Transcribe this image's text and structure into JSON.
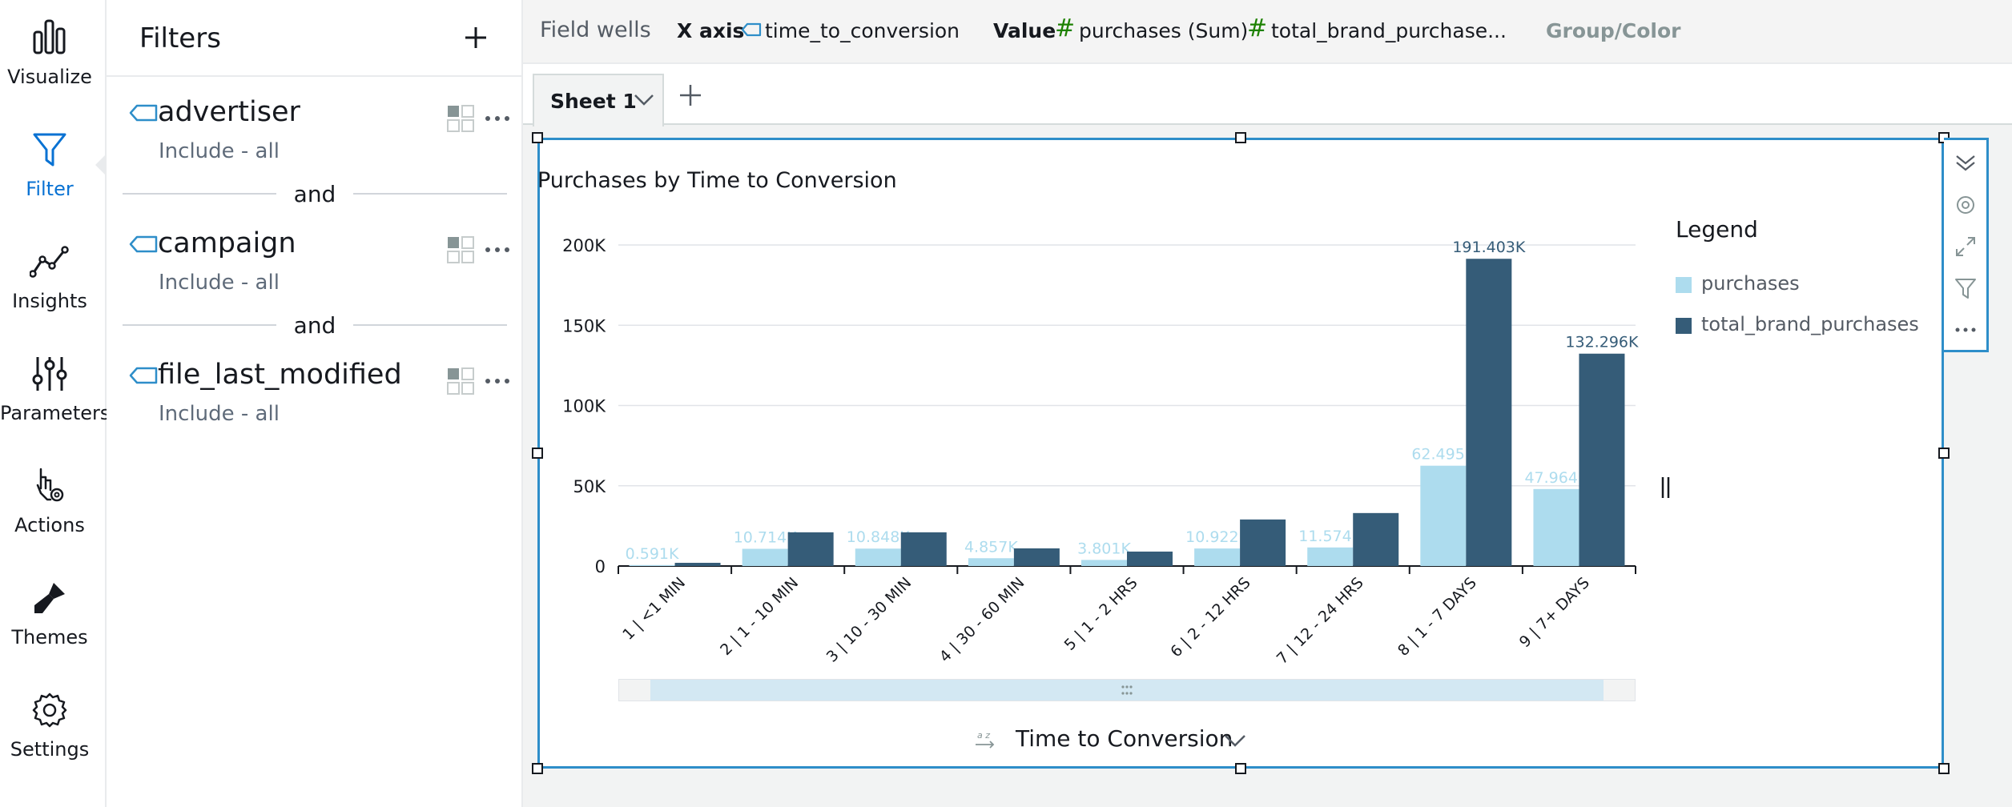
{
  "rail": {
    "items": [
      {
        "label": "Visualize",
        "icon": "bar-chart-icon"
      },
      {
        "label": "Filter",
        "icon": "funnel-icon",
        "active": true
      },
      {
        "label": "Insights",
        "icon": "line-insight-icon"
      },
      {
        "label": "Parameters",
        "icon": "sliders-icon"
      },
      {
        "label": "Actions",
        "icon": "hand-gear-icon"
      },
      {
        "label": "Themes",
        "icon": "brush-icon"
      },
      {
        "label": "Settings",
        "icon": "gear-icon"
      }
    ]
  },
  "filters": {
    "title": "Filters",
    "add_icon": "plus-icon",
    "connector": "and",
    "items": [
      {
        "name": "advertiser",
        "sub": "Include - all"
      },
      {
        "name": "campaign",
        "sub": "Include - all"
      },
      {
        "name": "file_last_modified",
        "sub": "Include - all"
      }
    ]
  },
  "wells": {
    "label": "Field wells",
    "x_axis_label": "X axis",
    "x_axis_field": "time_to_conversion",
    "value_label": "Value",
    "value_field_1": "purchases (Sum)",
    "value_field_2": "total_brand_purchase...",
    "group_label": "Group/Color"
  },
  "sheet": {
    "tab_label": "Sheet 1",
    "add_icon": "plus-icon"
  },
  "visual": {
    "title": "Purchases by Time to Conversion",
    "legend_title": "Legend",
    "x_control_label": "Time to Conversion"
  },
  "colors": {
    "accent": "#0972d3",
    "selection_border": "#2e8ec9",
    "purchases": "#addcee",
    "total_brand_purchases": "#355c78",
    "well_value_icon": "#1d8102"
  },
  "chart_data": {
    "type": "bar",
    "title": "Purchases by Time to Conversion",
    "xlabel": "Time to Conversion",
    "ylabel": "",
    "ylim": [
      0,
      200000
    ],
    "yticks": [
      {
        "value": 0,
        "label": "0"
      },
      {
        "value": 50000,
        "label": "50K"
      },
      {
        "value": 100000,
        "label": "100K"
      },
      {
        "value": 150000,
        "label": "150K"
      },
      {
        "value": 200000,
        "label": "200K"
      }
    ],
    "grid": true,
    "legend_position": "right",
    "categories": [
      "1 | <1 MIN",
      "2 | 1 - 10 MIN",
      "3 | 10 - 30 MIN",
      "4 | 30 - 60 MIN",
      "5 | 1 - 2 HRS",
      "6 | 2 - 12 HRS",
      "7 | 12 - 24 HRS",
      "8 | 1 - 7 DAYS",
      "9 | 7+ DAYS"
    ],
    "series": [
      {
        "name": "purchases",
        "values": [
          591,
          10714,
          10848,
          4857,
          3801,
          10922,
          11574,
          62495,
          47964
        ],
        "labels": [
          "0.591K",
          "10.714K",
          "10.848K",
          "4.857K",
          "3.801K",
          "10.922K",
          "11.574K",
          "62.495K",
          "47.964K"
        ]
      },
      {
        "name": "total_brand_purchases",
        "values": [
          2000,
          21000,
          21000,
          11000,
          9000,
          29000,
          33000,
          191403,
          132296
        ],
        "labels": [
          "",
          "",
          "",
          "",
          "",
          "",
          "",
          "191.403K",
          "132.296K"
        ]
      }
    ]
  }
}
